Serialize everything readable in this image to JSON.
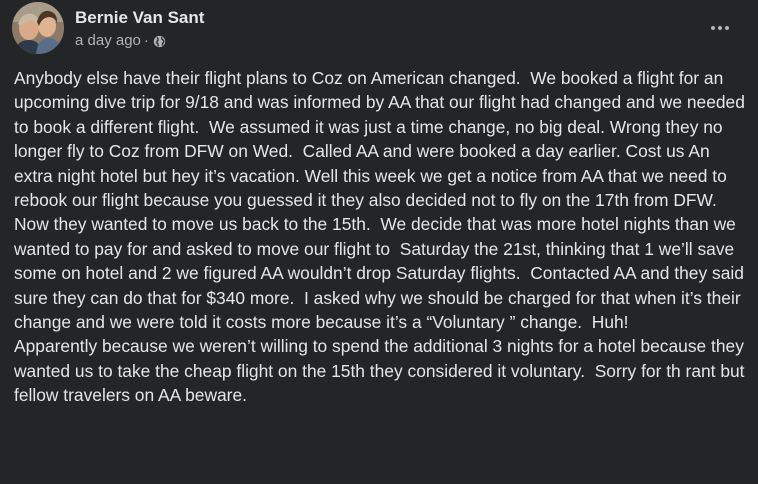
{
  "post": {
    "author": "Bernie Van Sant",
    "timestamp": "a day ago",
    "separator": "·",
    "audience_icon": "globe-icon",
    "more_icon": "more-options-icon",
    "paragraphs": [
      "Anybody else have their flight plans to Coz on American changed.  We booked a flight for an upcoming dive trip for 9/18 and was informed by AA that our flight had changed and we needed to book a different flight.  We assumed it was just a time change, no big deal. Wrong they no longer fly to Coz from DFW on Wed.  Called AA and were booked a day earlier. Cost us An extra night hotel but hey it’s vacation. Well this week we get a notice from AA that we need to rebook our flight because you guessed it they also decided not to fly on the 17th from DFW.  Now they wanted to move us back to the 15th.  We decide that was more hotel nights than we wanted to pay for and asked to move our flight to  Saturday the 21st, thinking that 1 we’ll save some on hotel and 2 we figured AA wouldn’t drop Saturday flights.  Contacted AA and they said sure they can do that for $340 more.  I asked why we should be charged for that when it’s their change and we were told it costs more because it’s a “Voluntary ” change.  Huh!",
      "Apparently because we weren’t willing to spend the additional 3 nights for a hotel because they wanted us to take the cheap flight on the 15th they considered it voluntary.  Sorry for th rant but fellow travelers on AA beware."
    ]
  }
}
